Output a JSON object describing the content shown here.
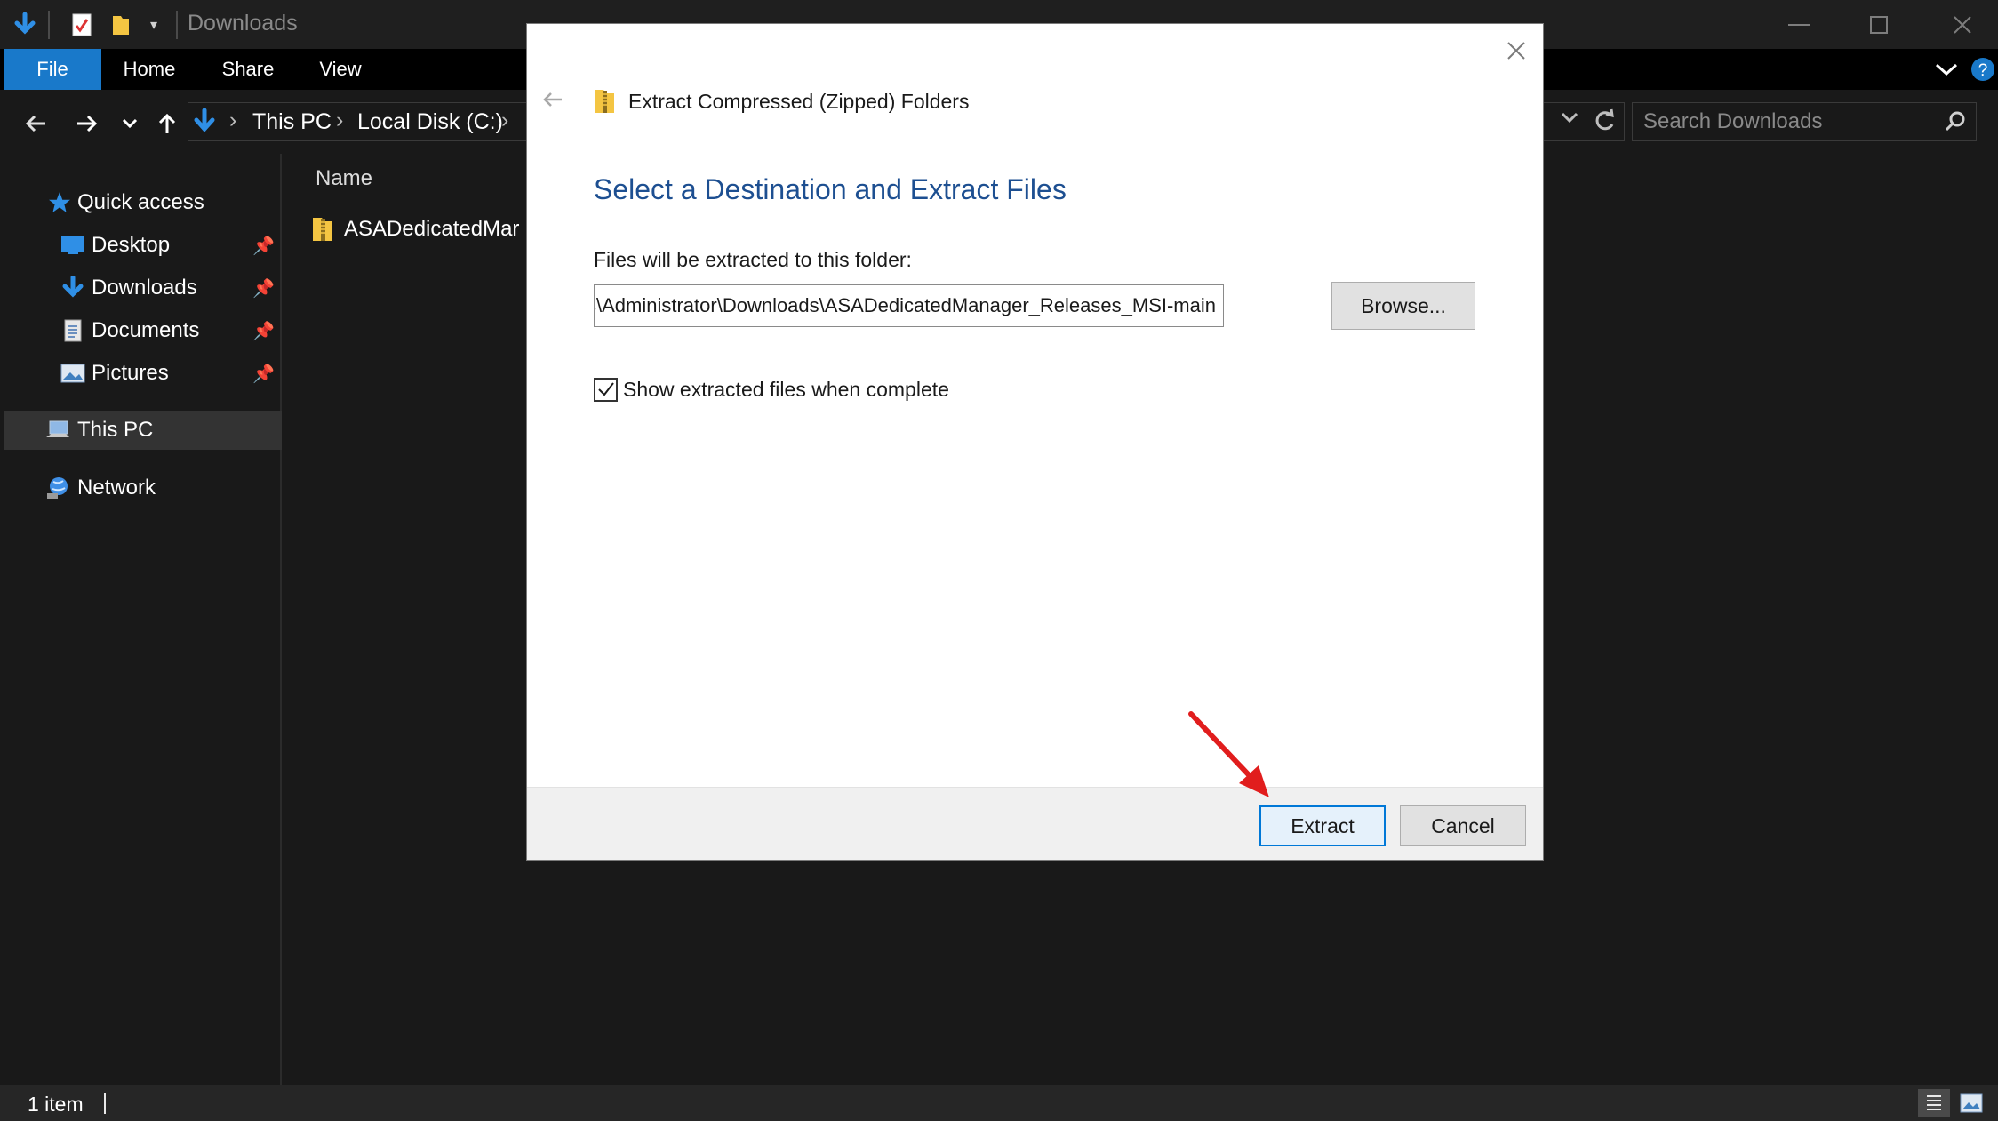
{
  "window": {
    "title": "Downloads",
    "minimize_icon": "minimize-icon",
    "maximize_icon": "maximize-icon",
    "close_icon": "close-icon"
  },
  "ribbon": {
    "tabs": [
      {
        "label": "File"
      },
      {
        "label": "Home"
      },
      {
        "label": "Share"
      },
      {
        "label": "View"
      }
    ]
  },
  "address": {
    "crumbs": [
      "This PC",
      "Local Disk (C:)"
    ],
    "search_placeholder": "Search Downloads"
  },
  "navpane": {
    "items": [
      {
        "label": "Quick access"
      },
      {
        "label": "Desktop"
      },
      {
        "label": "Downloads"
      },
      {
        "label": "Documents"
      },
      {
        "label": "Pictures"
      },
      {
        "label": "This PC"
      },
      {
        "label": "Network"
      }
    ]
  },
  "content": {
    "column_name": "Name",
    "files": [
      {
        "name": "ASADedicatedMar"
      }
    ]
  },
  "status": {
    "item_count": "1 item"
  },
  "dialog": {
    "window_title": "Extract Compressed (Zipped) Folders",
    "heading": "Select a Destination and Extract Files",
    "folder_label": "Files will be extracted to this folder:",
    "path_value": "C:\\Users\\Administrator\\Downloads\\ASADedicatedManager_Releases_MSI-main",
    "browse_label": "Browse...",
    "show_files_label": "Show extracted files when complete",
    "show_files_checked": true,
    "extract_label": "Extract",
    "cancel_label": "Cancel"
  },
  "colors": {
    "accent": "#1979ca",
    "heading_blue": "#1d4f91",
    "arrow_red": "#e11d1d"
  }
}
